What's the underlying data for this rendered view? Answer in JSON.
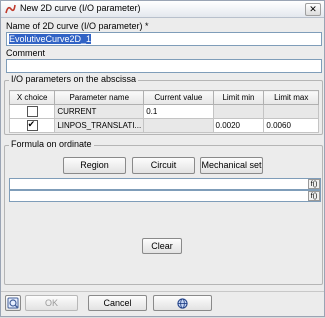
{
  "window": {
    "title": "New 2D curve (I/O parameter)",
    "close_glyph": "✕"
  },
  "name": {
    "label": "Name of  2D curve (I/O parameter) *",
    "value": "EvolutiveCurve2D_1"
  },
  "comment": {
    "label": "Comment",
    "value": ""
  },
  "abscissa": {
    "legend": "I/O parameters on the abscissa",
    "headers": [
      "X choice",
      "Parameter name",
      "Current value",
      "Limit min",
      "Limit max"
    ],
    "rows": [
      {
        "checked": false,
        "name": "CURRENT",
        "current": "0.1",
        "min": "",
        "max": ""
      },
      {
        "checked": true,
        "name": "LINPOS_TRANSLATI...",
        "current": "",
        "min": "0.0020",
        "max": "0.0060"
      }
    ]
  },
  "ordinate": {
    "legend": "Formula on ordinate",
    "buttons": {
      "region": "Region",
      "circuit": "Circuit",
      "mechanical": "Mechanical set"
    },
    "formula_button": "f()",
    "clear": "Clear"
  },
  "footer": {
    "ok": "OK",
    "cancel": "Cancel"
  },
  "icons": {
    "app": "curve-app-icon",
    "help": "help-icon",
    "globe": "globe-icon"
  }
}
